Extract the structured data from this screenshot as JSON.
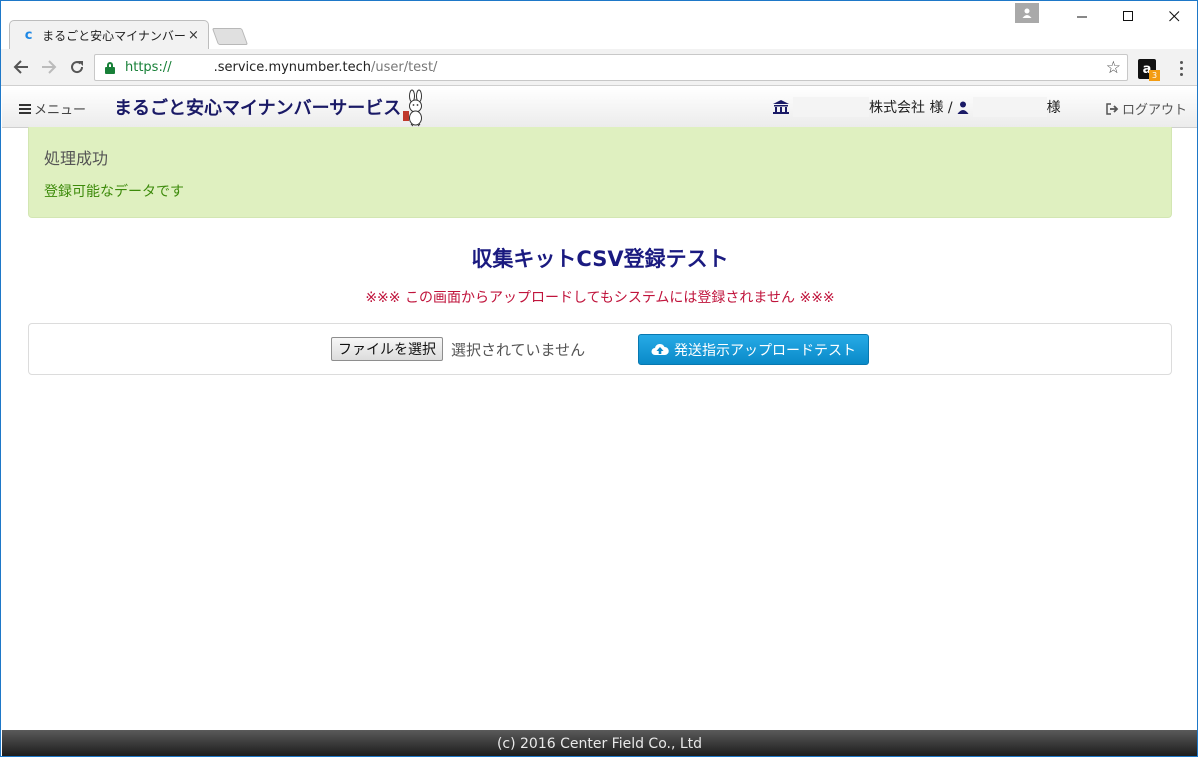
{
  "browser": {
    "tab_title": "まるごと安心マイナンバー",
    "tab_favicon": "c",
    "tab_close": "×",
    "url_scheme": "https://",
    "url_host": ".service.mynumber.tech",
    "url_path": "/user/test/",
    "extension_badge": "3",
    "extension_letter": "a"
  },
  "navbar": {
    "menu_label": "メニュー",
    "brand": "まるごと安心マイナンバーサービス",
    "company_suffix": "株式会社 様 /",
    "user_suffix": "様",
    "logout_label": "ログアウト"
  },
  "alert": {
    "title": "処理成功",
    "message": "登録可能なデータです"
  },
  "main": {
    "title": "収集キットCSV登録テスト",
    "warning": "※※※ この画面からアップロードしてもシステムには登録されません ※※※",
    "file_button": "ファイルを選択",
    "file_status": "選択されていません",
    "upload_button": "発送指示アップロードテスト"
  },
  "footer": {
    "copyright": "(c) 2016 Center Field Co., Ltd"
  },
  "icons": {
    "back": "arrow-left-icon",
    "forward": "arrow-right-icon",
    "reload": "reload-icon",
    "lock": "lock-icon",
    "star": "star-icon",
    "bank": "bank-icon",
    "user": "user-icon",
    "logout": "sign-out-icon",
    "cloud": "cloud-upload-icon"
  },
  "colors": {
    "brand": "#1a1a66",
    "alert_bg": "#dff0c0",
    "alert_text": "#3c8a0a",
    "warning": "#c0143c",
    "title": "#1a1a80",
    "primary_button": "#0a8ac8"
  }
}
